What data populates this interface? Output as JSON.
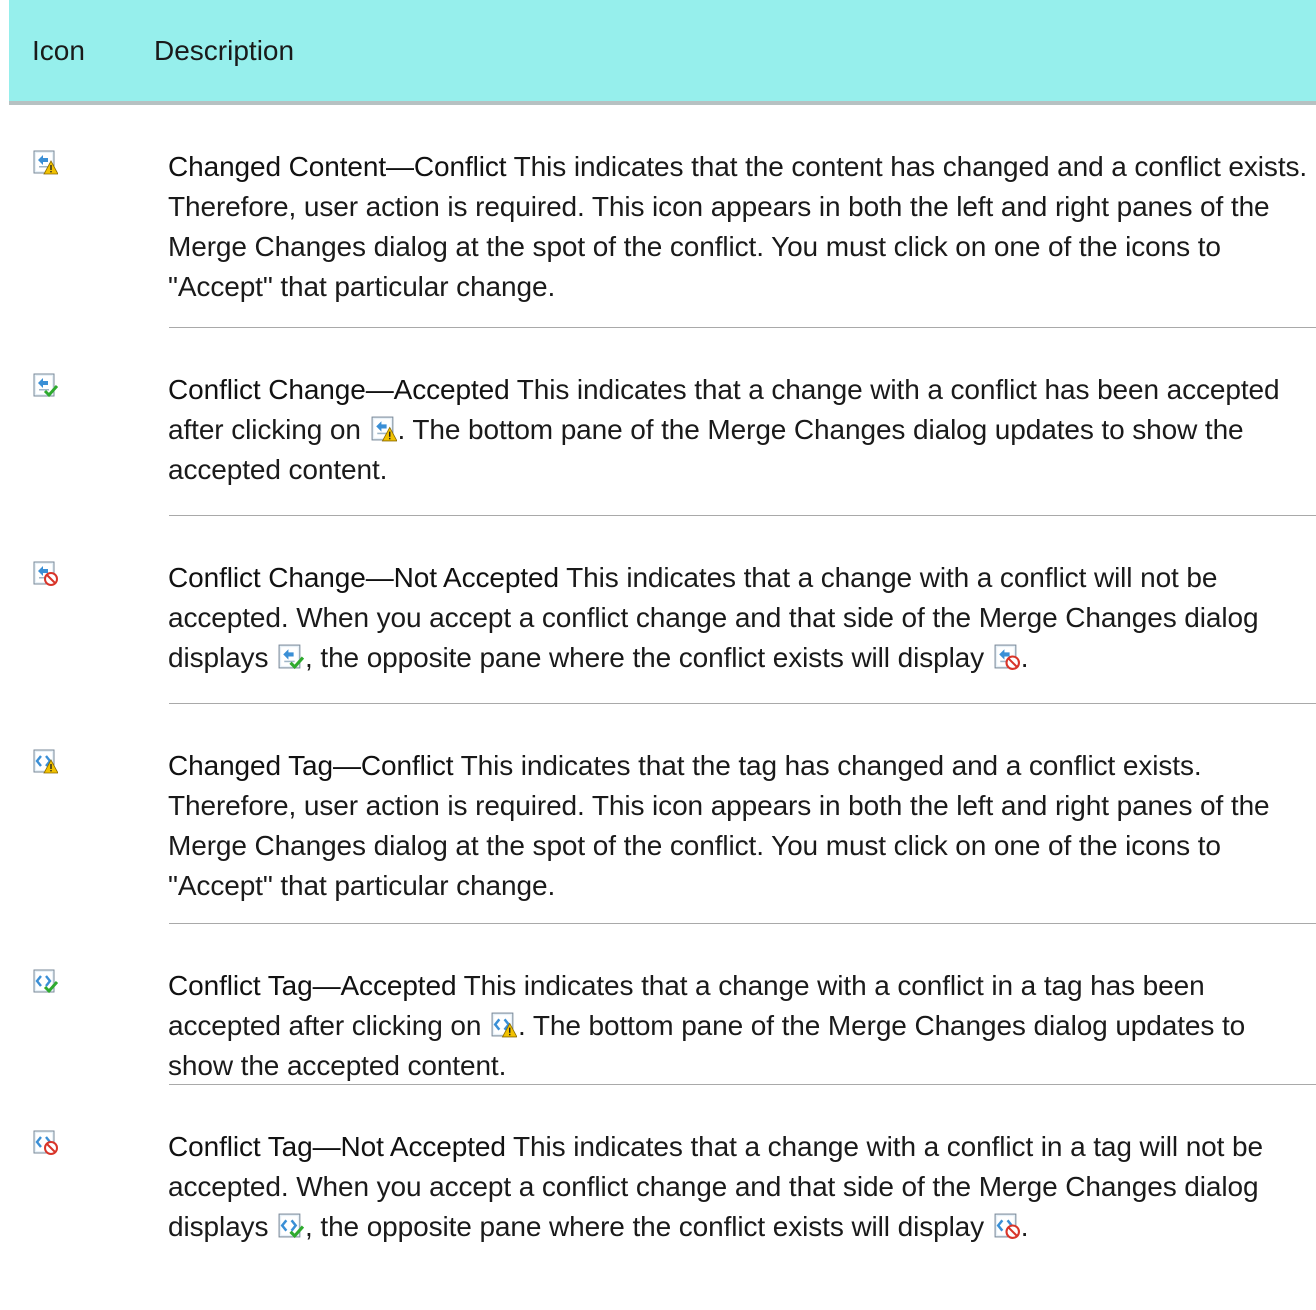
{
  "header": {
    "icon_col": "Icon",
    "description_col": "Description"
  },
  "rows": [
    {
      "icon": "changed-content-conflict-icon",
      "title": "Changed Content—Conflict",
      "text_a": " This indicates that the content has changed and a conflict exists. Therefore, user action is required. This icon appears in both the left and right panes of the Merge Changes dialog at the spot of the conflict. You must click on one of the icons to \"Accept\" that particular change."
    },
    {
      "icon": "conflict-change-accepted-icon",
      "title": "Conflict Change—Accepted",
      "text_a": " This indicates that a change with a conflict has been accepted after clicking on ",
      "inline_icon_1": "changed-content-conflict-icon",
      "text_b": ". The bottom pane of the Merge Changes dialog updates to show the accepted content."
    },
    {
      "icon": "conflict-change-not-accepted-icon",
      "title": "Conflict Change—Not Accepted",
      "text_a": " This indicates that a change with a conflict will not be accepted. When you accept a conflict change and that side of the Merge Changes dialog displays ",
      "inline_icon_1": "conflict-change-accepted-icon",
      "text_b": ", the opposite pane where the conflict exists will display ",
      "inline_icon_2": "conflict-change-not-accepted-icon",
      "text_c": "."
    },
    {
      "icon": "changed-tag-conflict-icon",
      "title": "Changed Tag—Conflict",
      "text_a": " This indicates that the tag has changed and a conflict exists. Therefore, user action is required. This icon appears in both the left and right panes of the Merge Changes dialog at the spot of the conflict. You must click on one of the icons to \"Accept\" that particular change."
    },
    {
      "icon": "conflict-tag-accepted-icon",
      "title": "Conflict Tag—Accepted",
      "text_a": " This indicates that a change with a conflict in a tag has been accepted after clicking on ",
      "inline_icon_1": "changed-tag-conflict-icon",
      "text_b": ". The bottom pane of the Merge Changes dialog updates to show the accepted content."
    },
    {
      "icon": "conflict-tag-not-accepted-icon",
      "title": "Conflict Tag—Not Accepted",
      "text_a": " This indicates that a change with a conflict in a tag will not be accepted. When you accept a conflict change and that side of the Merge Changes dialog displays ",
      "inline_icon_1": "conflict-tag-accepted-icon",
      "text_b": ", the opposite pane where the conflict exists will display ",
      "inline_icon_2": "conflict-tag-not-accepted-icon",
      "text_c": "."
    }
  ],
  "colors": {
    "header_bg": "#96efec",
    "divider": "#a9a9a9",
    "warning_yellow": "#f2c200",
    "accept_green": "#2eaa2e",
    "reject_red": "#d8352a",
    "arrow_blue": "#3a8fd6"
  }
}
